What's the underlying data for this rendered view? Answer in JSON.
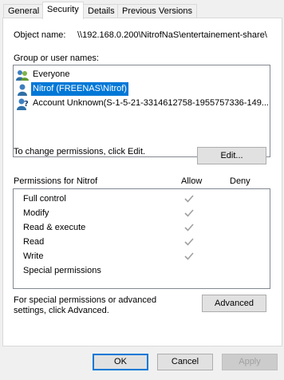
{
  "tabs": [
    "General",
    "Security",
    "Details",
    "Previous Versions"
  ],
  "active_tab": "Security",
  "object": {
    "label": "Object name:",
    "value": "\\\\192.168.0.200\\NitrofNaS\\entertainement-share\\"
  },
  "groups": {
    "label": "Group or user names:",
    "items": [
      {
        "name": "Everyone",
        "icon": "users-group-icon"
      },
      {
        "name": "Nitrof (FREENAS\\Nitrof)",
        "icon": "user-icon",
        "selected": true
      },
      {
        "name": "Account Unknown(S-1-5-21-3314612758-1955757336-149...",
        "icon": "unknown-user-icon"
      }
    ]
  },
  "change_text": "To change permissions, click Edit.",
  "edit_label": "Edit...",
  "permissions": {
    "header": "Permissions for Nitrof",
    "allow_label": "Allow",
    "deny_label": "Deny",
    "rows": [
      {
        "name": "Full control",
        "allow": true,
        "deny": false
      },
      {
        "name": "Modify",
        "allow": true,
        "deny": false
      },
      {
        "name": "Read & execute",
        "allow": true,
        "deny": false
      },
      {
        "name": "Read",
        "allow": true,
        "deny": false
      },
      {
        "name": "Write",
        "allow": true,
        "deny": false
      },
      {
        "name": "Special permissions",
        "allow": false,
        "deny": false
      }
    ]
  },
  "special_text": "For special permissions or advanced settings, click Advanced.",
  "advanced_label": "Advanced",
  "footer": {
    "ok": "OK",
    "cancel": "Cancel",
    "apply": "Apply"
  },
  "colors": {
    "selection": "#0078d7",
    "check": "#a0a0a0"
  }
}
